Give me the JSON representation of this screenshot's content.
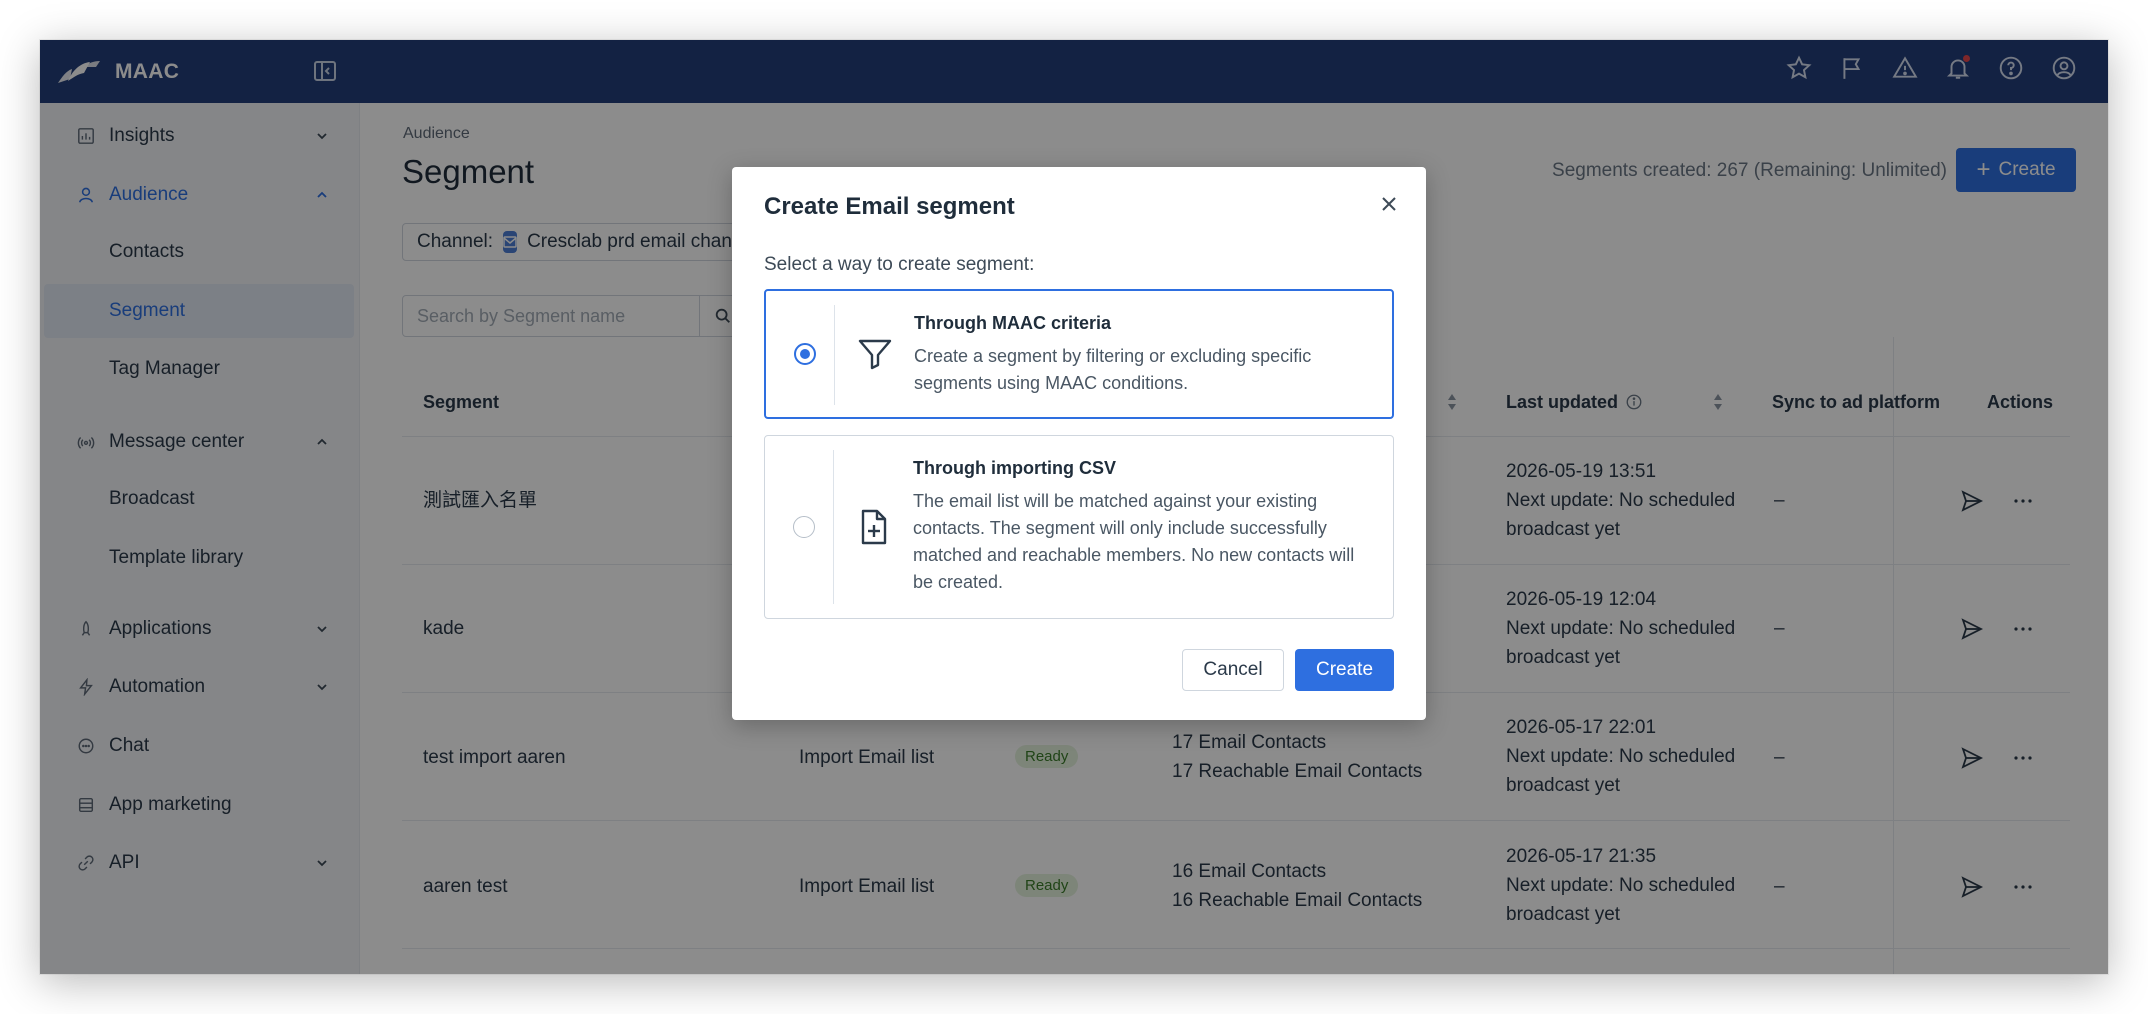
{
  "app": {
    "name": "MAAC"
  },
  "sidebar": {
    "items": [
      {
        "label": "Insights",
        "icon": "chart-board-icon",
        "expanded": false
      },
      {
        "label": "Audience",
        "icon": "user-icon",
        "expanded": true,
        "active": true
      },
      {
        "label": "Contacts"
      },
      {
        "label": "Segment",
        "active": true
      },
      {
        "label": "Tag Manager"
      },
      {
        "label": "Message center",
        "icon": "broadcast-icon",
        "expanded": true
      },
      {
        "label": "Broadcast"
      },
      {
        "label": "Template library"
      },
      {
        "label": "Applications",
        "icon": "rocket-icon",
        "expanded": false
      },
      {
        "label": "Automation",
        "icon": "lightning-icon",
        "expanded": false
      },
      {
        "label": "Chat",
        "icon": "chat-bubble-icon"
      },
      {
        "label": "App marketing",
        "icon": "app-icon"
      },
      {
        "label": "API",
        "icon": "link-icon",
        "expanded": false
      }
    ]
  },
  "page": {
    "breadcrumb": "Audience",
    "title": "Segment",
    "segments_count": "Segments created: 267 (Remaining: Unlimited)",
    "create_label": "Create",
    "channel_label": "Channel:",
    "channel_value": "Cresclab prd email channel",
    "search_placeholder": "Search by Segment name"
  },
  "table": {
    "headers": {
      "segment": "Segment",
      "last_updated": "Last updated",
      "sync": "Sync to ad platform",
      "actions": "Actions"
    },
    "rows": [
      {
        "name": "測試匯入名單",
        "type": "",
        "status": "",
        "contacts": "",
        "reachable": "",
        "updated": "2026-05-19 13:51",
        "next1": "Next update: No scheduled",
        "next2": "broadcast yet",
        "sync": "–"
      },
      {
        "name": "kade",
        "type": "",
        "status": "",
        "contacts": "",
        "reachable": "",
        "updated": "2026-05-19 12:04",
        "next1": "Next update: No scheduled",
        "next2": "broadcast yet",
        "sync": "–"
      },
      {
        "name": "test import aaren",
        "type": "Import Email list",
        "status": "Ready",
        "contacts": "17 Email Contacts",
        "reachable": "17 Reachable Email Contacts",
        "updated": "2026-05-17 22:01",
        "next1": "Next update: No scheduled",
        "next2": "broadcast yet",
        "sync": "–"
      },
      {
        "name": "aaren test",
        "type": "Import Email list",
        "status": "Ready",
        "contacts": "16 Email Contacts",
        "reachable": "16 Reachable Email Contacts",
        "updated": "2026-05-17 21:35",
        "next1": "Next update: No scheduled",
        "next2": "broadcast yet",
        "sync": "–"
      }
    ]
  },
  "modal": {
    "title": "Create Email segment",
    "subtitle": "Select a way to create segment:",
    "options": [
      {
        "title": "Through MAAC criteria",
        "description": "Create a segment by filtering or excluding specific segments using MAAC conditions.",
        "selected": true,
        "icon": "funnel-icon"
      },
      {
        "title": "Through importing CSV",
        "description": "The email list will be matched against your existing contacts. The segment will only include successfully matched and reachable members. No new contacts will be created.",
        "selected": false,
        "icon": "file-plus-icon"
      }
    ],
    "cancel_label": "Cancel",
    "create_label": "Create"
  },
  "colors": {
    "topbar": "#243f7a",
    "accent": "#2e6fe0",
    "ready_badge": "#e4f2dc"
  }
}
